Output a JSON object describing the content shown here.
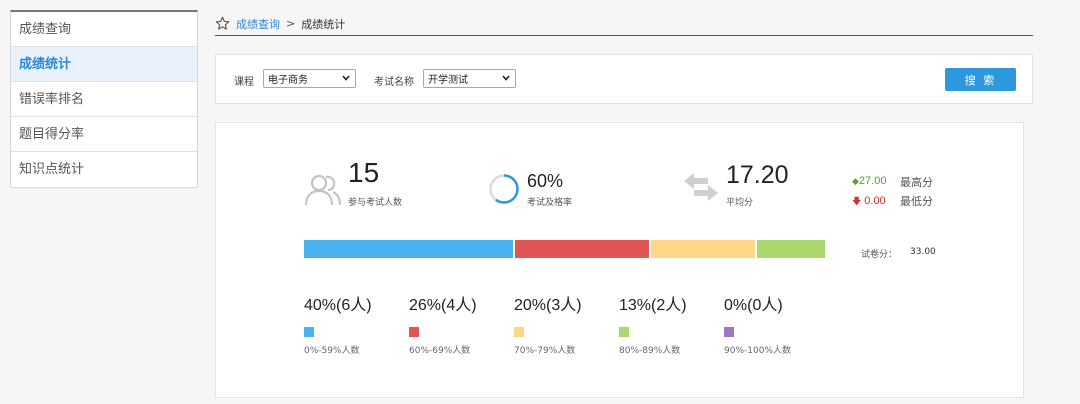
{
  "sidebar": {
    "items": [
      {
        "label": "成绩查询"
      },
      {
        "label": "成绩统计"
      },
      {
        "label": "错误率排名"
      },
      {
        "label": "题目得分率"
      },
      {
        "label": "知识点统计"
      }
    ]
  },
  "breadcrumb": {
    "root": "成绩查询",
    "separator": ">",
    "current": "成绩统计"
  },
  "filter": {
    "course_label": "课程",
    "course_value": "电子商务",
    "exam_label": "考试名称",
    "exam_value": "开学测试",
    "search_label": "搜 索"
  },
  "stats": {
    "participants": {
      "value": "15",
      "label": "参与考试人数"
    },
    "pass_rate": {
      "value": "60%",
      "label": "考试及格率",
      "fraction": 0.6
    },
    "average": {
      "value": "17.20",
      "label": "平均分"
    },
    "highest": {
      "value": "27.00",
      "label": "最高分"
    },
    "lowest": {
      "value": "0.00",
      "label": "最低分"
    },
    "total_score": {
      "label": "试卷分：",
      "value": "33.00"
    }
  },
  "distribution": [
    {
      "pct": "40%(6人)",
      "range": "0%-59%人数",
      "color": "#4ab3ef",
      "share": 0.4
    },
    {
      "pct": "26%(4人)",
      "range": "60%-69%人数",
      "color": "#e25555",
      "share": 0.26
    },
    {
      "pct": "20%(3人)",
      "range": "70%-79%人数",
      "color": "#fdd786",
      "share": 0.2
    },
    {
      "pct": "13%(2人)",
      "range": "80%-89%人数",
      "color": "#aad86e",
      "share": 0.13
    },
    {
      "pct": "0%(0人)",
      "range": "90%-100%人数",
      "color": "#9a78c4",
      "share": 0.0
    }
  ],
  "colors": {
    "accent": "#2a87d8",
    "button": "#2d98de",
    "up": "#5a9e2f",
    "down": "#d0312d"
  }
}
